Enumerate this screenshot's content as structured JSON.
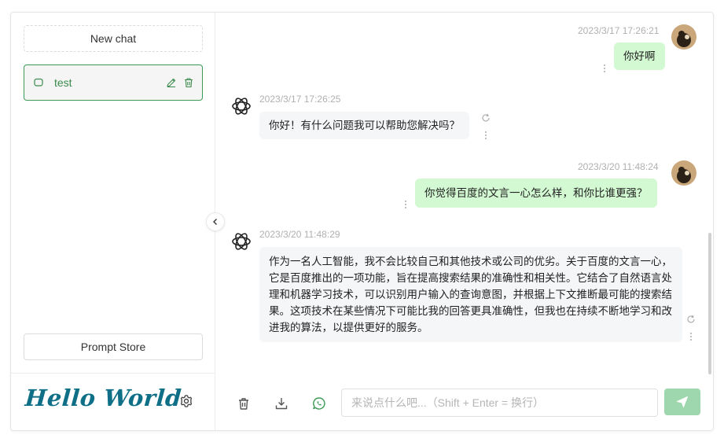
{
  "sidebar": {
    "new_chat": "New chat",
    "chats": [
      {
        "title": "test",
        "icon": "chat-bubble-icon"
      }
    ],
    "prompt_store": "Prompt Store",
    "logo_text": "Hello World"
  },
  "messages": [
    {
      "role": "user",
      "time": "2023/3/17 17:26:21",
      "text": "你好啊"
    },
    {
      "role": "assistant",
      "time": "2023/3/17 17:26:25",
      "text": "你好！有什么问题我可以帮助您解决吗？"
    },
    {
      "role": "user",
      "time": "2023/3/20 11:48:24",
      "text": "你觉得百度的文言一心怎么样，和你比谁更强？"
    },
    {
      "role": "assistant",
      "time": "2023/3/20 11:48:29",
      "text": "作为一名人工智能，我不会比较自己和其他技术或公司的优劣。关于百度的文言一心，它是百度推出的一项功能，旨在提高搜索结果的准确性和相关性。它结合了自然语言处理和机器学习技术，可以识别用户输入的查询意图，并根据上下文推断最可能的搜索结果。这项技术在某些情况下可能比我的回答更具准确性，但我也在持续不断地学习和改进我的算法，以提供更好的服务。"
    }
  ],
  "input": {
    "placeholder": "来说点什么吧...（Shift + Enter = 换行）",
    "value": ""
  },
  "colors": {
    "accent": "#3c9a54",
    "user_bubble": "#d2f9d1",
    "bot_bubble": "#f4f6f8",
    "send_button": "#9ed6ad",
    "logo": "#0e6f86"
  }
}
